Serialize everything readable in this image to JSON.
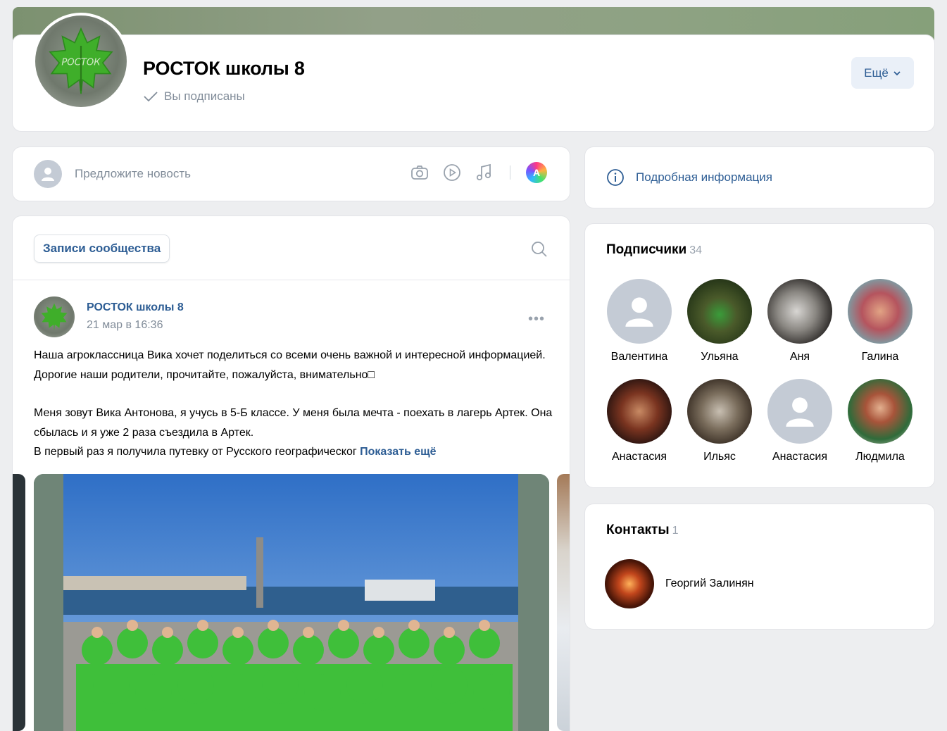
{
  "header": {
    "group_name": "РОСТОК школы 8",
    "subscribed_label": "Вы подписаны",
    "more_label": "Ещё",
    "avatar_text": "РОСТОК"
  },
  "composer": {
    "placeholder": "Предложите новость",
    "ai_letter": "A"
  },
  "feed": {
    "tab_label": "Записи сообщества",
    "post": {
      "author": "РОСТОК школы 8",
      "date": "21 мар в 16:36",
      "menu": "•••",
      "paragraph1": "Наша агроклассница Вика хочет поделиться со всеми очень важной и интересной информацией. Дорогие наши родители, прочитайте, пожалуйста, внимательно□",
      "paragraph2_line1": "Меня зовут Вика Антонова, я учусь в 5-Б классе. У меня была мечта - поехать в лагерь Артек. Она сбылась и я уже 2 раза съездила в Артек.",
      "paragraph2_line2": "В первый раз я получила путевку от Русского географическог",
      "show_more": "Показать ещё"
    }
  },
  "sidebar": {
    "info_label": "Подробная информация",
    "subscribers": {
      "title": "Подписчики",
      "count": "34",
      "items": [
        {
          "name": "Валентина"
        },
        {
          "name": "Ульяна"
        },
        {
          "name": "Аня"
        },
        {
          "name": "Галина"
        },
        {
          "name": "Анастасия"
        },
        {
          "name": "Ильяс"
        },
        {
          "name": "Анастасия"
        },
        {
          "name": "Людмила"
        }
      ]
    },
    "contacts": {
      "title": "Контакты",
      "count": "1",
      "items": [
        {
          "name": "Георгий Залинян"
        }
      ]
    }
  },
  "colors": {
    "link": "#2d5d94",
    "muted": "#818c99",
    "bg": "#edeef0",
    "cover": "#8ea283"
  }
}
